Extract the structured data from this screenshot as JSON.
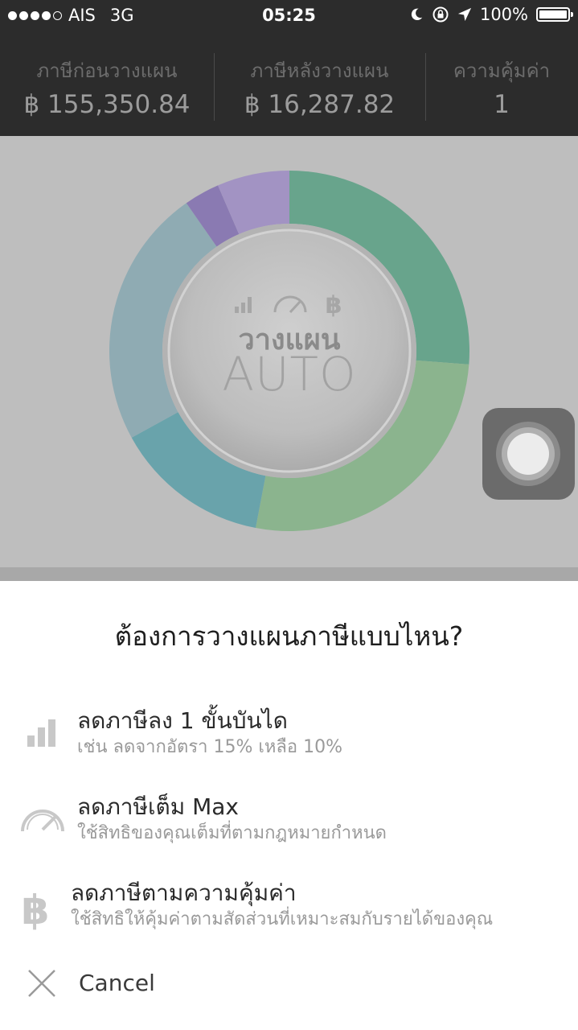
{
  "status_bar": {
    "carrier": "AIS",
    "network": "3G",
    "time": "05:25",
    "battery": "100%",
    "icons": [
      "moon-icon",
      "rotation-lock-icon",
      "location-arrow-icon",
      "battery-icon"
    ]
  },
  "summary": {
    "before": {
      "label": "ภาษีก่อนวางแผน",
      "value": "฿ 155,350.84"
    },
    "after": {
      "label": "ภาษีหลังวางแผน",
      "value": "฿ 16,287.82"
    },
    "worth": {
      "label": "ความคุ้มค่า",
      "value": "1"
    }
  },
  "chart": {
    "hub_title": "วางแผน",
    "hub_subtitle": "AUTO",
    "hub_icons": [
      "bar-chart-icon",
      "speedometer-icon",
      "baht-icon"
    ],
    "segments": [
      {
        "color": "#68a48c",
        "fraction": 0.262
      },
      {
        "color": "#8bb48e",
        "fraction": 0.268
      },
      {
        "color": "#69a3ab",
        "fraction": 0.14
      },
      {
        "color": "#8fabb3",
        "fraction": 0.233
      },
      {
        "color": "#8a7ab2",
        "fraction": 0.032
      },
      {
        "color": "#a293c3",
        "fraction": 0.065
      }
    ]
  },
  "sheet": {
    "question": "ต้องการวางแผนภาษีแบบไหน?",
    "options": [
      {
        "icon": "bar-chart-icon",
        "title": "ลดภาษีลง 1 ขั้นบันได",
        "desc": "เช่น ลดจากอัตรา 15% เหลือ 10%"
      },
      {
        "icon": "speedometer-icon",
        "title": "ลดภาษีเต็ม Max",
        "desc": "ใช้สิทธิของคุณเต็มที่ตามกฎหมายกำหนด"
      },
      {
        "icon": "baht-icon",
        "title": "ลดภาษีตามความคุ้มค่า",
        "desc": "ใช้สิทธิให้คุ้มค่าตามสัดส่วนที่เหมาะสมกับรายได้ของคุณ"
      }
    ],
    "cancel_label": "Cancel"
  }
}
